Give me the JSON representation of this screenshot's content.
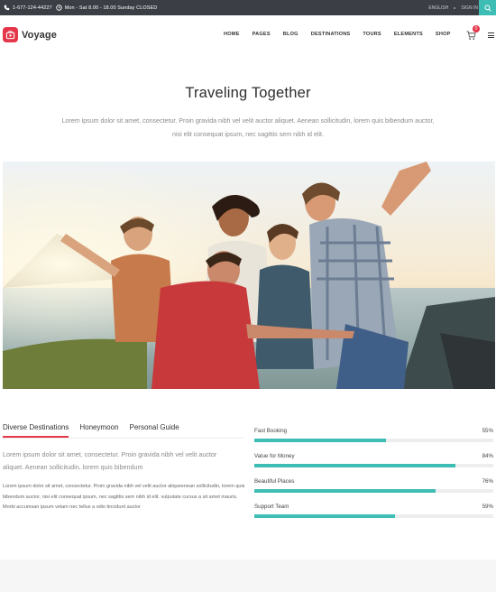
{
  "topbar": {
    "phone": "1-677-124-44227",
    "hours": "Mon - Sat 8.00 - 18.00 Sunday CLOSED",
    "language": "ENGLISH",
    "sign_in": "SIGN IN"
  },
  "brand": {
    "name": "Voyage"
  },
  "menu": {
    "items": [
      {
        "label": "HOME"
      },
      {
        "label": "PAGES"
      },
      {
        "label": "BLOG"
      },
      {
        "label": "DESTINATIONS"
      },
      {
        "label": "TOURS"
      },
      {
        "label": "ELEMENTS"
      },
      {
        "label": "SHOP"
      }
    ]
  },
  "cart": {
    "count": "0"
  },
  "hero": {
    "title": "Traveling Together",
    "text": "Lorem ipsum dolor sit amet, consectetur. Proin gravida nibh vel velit auctor aliquet. Aenean sollicitudin, lorem quis bibendum auctor, nisi elit consequat ipsum, nec sagittis sem nibh id elit."
  },
  "tabs": {
    "items": [
      {
        "label": "Diverse Destinations"
      },
      {
        "label": "Honeymoon"
      },
      {
        "label": "Personal Guide"
      }
    ],
    "lead": "Lorem ipsum dolor sit amet, consectetur. Proin gravida nibh vel velit auctor aliquet. Aenean sollicitudin, lorem quis bibendum",
    "body": "Lorem ipsum dolor sit amet, consectetur. Proin gravida nibh vel velit auctor aliqueenean sollicitudin, lorem quis bibendum auctor, nisi elit consequat ipsum, nec sagittis sem nibh id elit. vulputate cursus a sit amet mauris. Morbi accumsan ipsum velam nec tellus a odio tincidunt auctor"
  },
  "stats": [
    {
      "label": "Fast Booking",
      "percent": 55,
      "percent_text": "55%"
    },
    {
      "label": "Value for Money",
      "percent": 84,
      "percent_text": "84%"
    },
    {
      "label": "Beautiful Places",
      "percent": 76,
      "percent_text": "76%"
    },
    {
      "label": "Support Team",
      "percent": 59,
      "percent_text": "59%"
    }
  ],
  "colors": {
    "accent_red": "#e4374a",
    "accent_teal": "#3ebdb4",
    "topbar_bg": "#3b3f45"
  },
  "icons": {
    "phone": "phone-icon",
    "clock": "clock-icon",
    "search": "search-icon",
    "cart": "cart-icon",
    "menu": "hamburger-icon",
    "logo": "suitcase-icon"
  }
}
